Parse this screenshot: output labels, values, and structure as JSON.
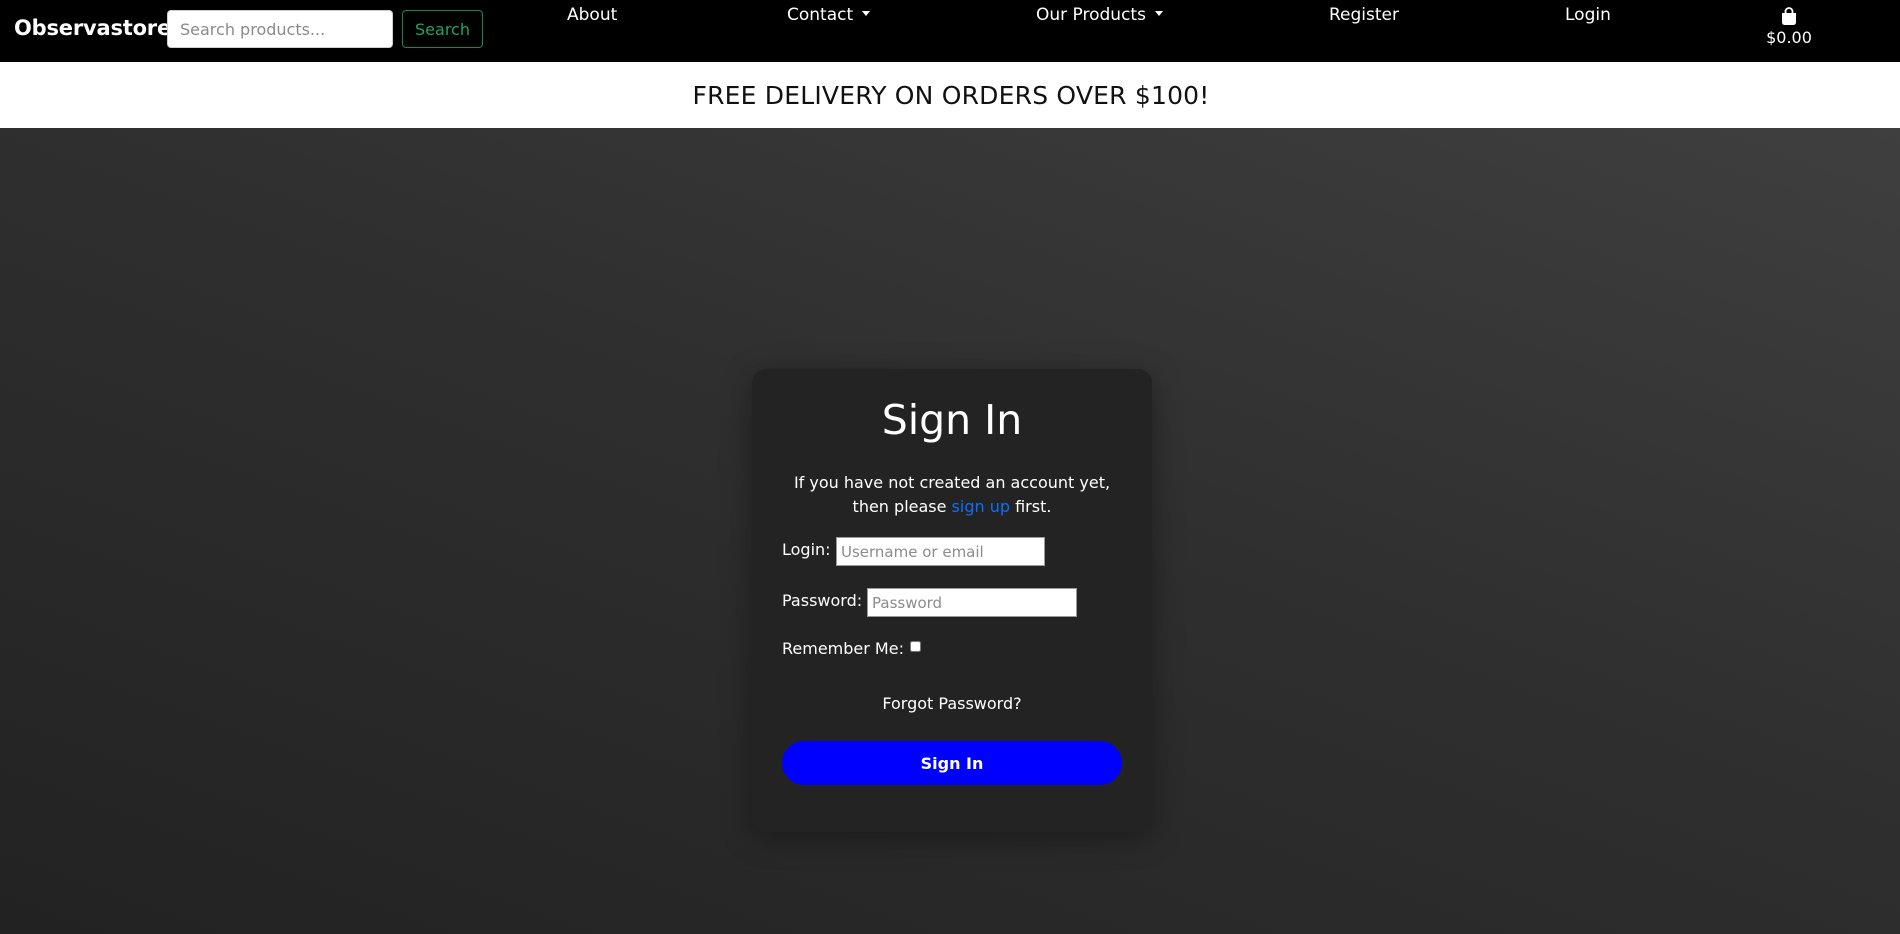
{
  "navbar": {
    "brand": "Observastore",
    "search": {
      "placeholder": "Search products...",
      "value": "",
      "button_label": "Search"
    },
    "links": {
      "about": "About",
      "contact": "Contact",
      "products": "Our Products",
      "register": "Register",
      "login": "Login"
    },
    "cart": {
      "icon": "shopping-bag-icon",
      "total": "$0.00"
    }
  },
  "promo": {
    "text": "FREE DELIVERY ON ORDERS OVER $100!"
  },
  "signin": {
    "title": "Sign In",
    "intro_prefix": "If you have not created an account yet,",
    "intro_then": "then please ",
    "intro_link": "sign up",
    "intro_suffix": " first.",
    "login_label": "Login:",
    "login_placeholder": "Username or email",
    "login_value": "",
    "password_label": "Password:",
    "password_placeholder": "Password",
    "password_value": "",
    "remember_label": "Remember Me:",
    "remember_checked": false,
    "forgot_link": "Forgot Password?",
    "submit_label": "Sign In"
  },
  "colors": {
    "navbar_bg": "#000000",
    "search_button_accent": "#198754",
    "link_blue": "#0d6efd",
    "submit_bg": "#0000ff",
    "card_bg": "#232323"
  }
}
